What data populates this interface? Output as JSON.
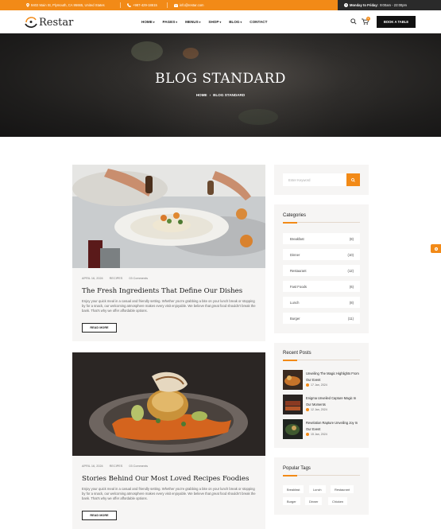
{
  "topbar": {
    "address": "9402 Main St, Plymouth, CA 95665, United States",
    "phone": "+987-429-18615",
    "email": "info@restar.com",
    "hours_label": "Monday to Friday:",
    "hours_value": "9:00am - 22:00pm"
  },
  "nav": {
    "logo": "Restar",
    "menu": [
      "HOME",
      "PAGES",
      "MENUS",
      "SHOP",
      "BLOG",
      "CONTACT"
    ],
    "cart_count": "0",
    "book_button": "BOOK A TABLE"
  },
  "hero": {
    "title": "BLOG STANDARD",
    "breadcrumb_home": "HOME",
    "breadcrumb_current": "BLOG STANDARD"
  },
  "posts": [
    {
      "date": "APRIL 16, 2024",
      "category": "RECIPES",
      "comments": "03 Comments",
      "title": "The Fresh Ingredients That Define Our Dishes",
      "excerpt": "Enjoy your quick meal in a casual and friendly setting. Whether you're grabbing a bite on your lunch break or stopping by for a snack, our welcoming atmosphere makes every visit enjoyable. We believe that great food shouldn't break the bank. That's why we offer affordable options.",
      "read_more": "READ MORE"
    },
    {
      "date": "APRIL 16, 2024",
      "category": "RECIPES",
      "comments": "03 Comments",
      "title": "Stories Behind Our Most Loved Recipes Foodies",
      "excerpt": "Enjoy your quick meal in a casual and friendly setting. Whether you're grabbing a bite on your lunch break or stopping by for a snack, our welcoming atmosphere makes every visit enjoyable. We believe that great food shouldn't break the bank. That's why we offer affordable options.",
      "read_more": "READ MORE"
    }
  ],
  "sidebar": {
    "search_placeholder": "Enter Keyword",
    "categories_title": "Categories",
    "categories": [
      {
        "name": "Breakfast",
        "count": "(8)"
      },
      {
        "name": "Dinner",
        "count": "(10)"
      },
      {
        "name": "Restaurant",
        "count": "(12)"
      },
      {
        "name": "Fast Foods",
        "count": "(6)"
      },
      {
        "name": "Lunch",
        "count": "(8)"
      },
      {
        "name": "Burger",
        "count": "(11)"
      }
    ],
    "recent_title": "Recent Posts",
    "recent": [
      {
        "title": "Unveiling The Magic Highlights From Our Event",
        "date": "17 Jan, 2024"
      },
      {
        "title": "Enigma Unveiled Capture Magic In Our Moments",
        "date": "12 Jan, 2024"
      },
      {
        "title": "Revelation Rapture Unveiling Joy In Our Event",
        "date": "15 Jan, 2024"
      }
    ],
    "tags_title": "Popular Tags",
    "tags": [
      "Breakfast",
      "Lunch",
      "Restaurant",
      "Burger",
      "Dinner",
      "Chicken"
    ]
  },
  "colors": {
    "accent": "#f28a17",
    "dark": "#111111",
    "panel": "#f6f5f4"
  }
}
